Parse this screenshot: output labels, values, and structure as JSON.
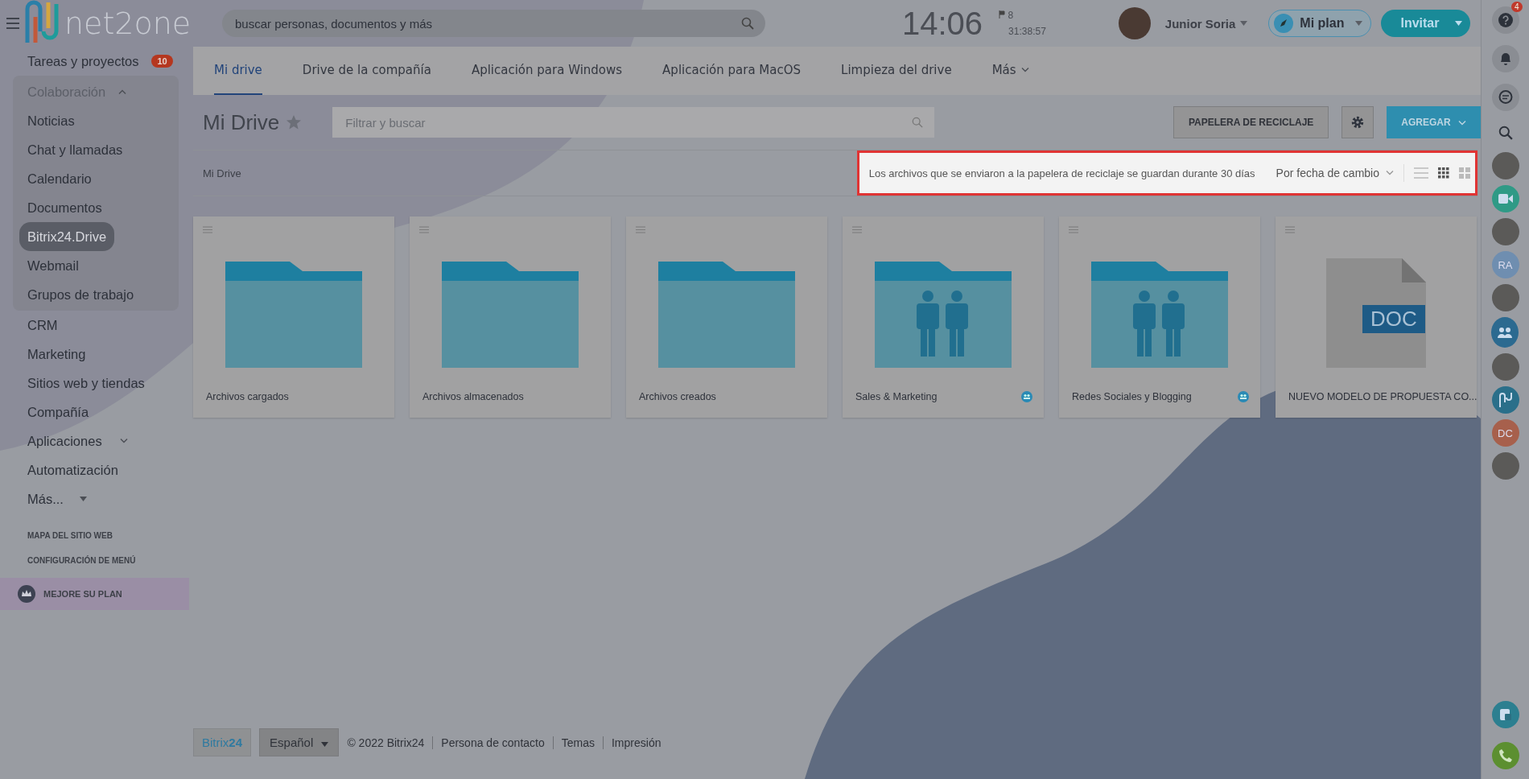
{
  "header": {
    "logo": "net2one",
    "search": {
      "placeholder": "buscar personas, documentos y más"
    },
    "clock": "14:06",
    "flag_count": "8",
    "timer": "31:38:57",
    "user": "Junior Soria",
    "plan_button": "Mi plan",
    "invite_button": "Invitar"
  },
  "sidebar": {
    "items": [
      {
        "label": "Tareas y proyectos",
        "badge": "10",
        "selected": false
      },
      {
        "label": "Colaboración",
        "expanded": true,
        "children": [
          {
            "label": "Noticias",
            "selected": false
          },
          {
            "label": "Chat y llamadas",
            "selected": false
          },
          {
            "label": "Calendario",
            "selected": false
          },
          {
            "label": "Documentos",
            "selected": false
          },
          {
            "label": "Bitrix24.Drive",
            "selected": true
          },
          {
            "label": "Webmail",
            "selected": false
          },
          {
            "label": "Grupos de trabajo",
            "selected": false
          }
        ]
      },
      {
        "label": "CRM",
        "selected": false
      },
      {
        "label": "Marketing",
        "selected": false
      },
      {
        "label": "Sitios web y tiendas",
        "selected": false
      },
      {
        "label": "Compañía",
        "selected": false
      },
      {
        "label": "Aplicaciones",
        "expanded": false,
        "selected": false
      },
      {
        "label": "Automatización",
        "selected": false
      },
      {
        "label": "Más...",
        "selected": false,
        "caret": true
      }
    ],
    "links": [
      "MAPA DEL SITIO WEB",
      "CONFIGURACIÓN DE MENÚ"
    ],
    "upgrade": "MEJORE SU PLAN"
  },
  "tabs": [
    {
      "label": "Mi drive",
      "selected": true
    },
    {
      "label": "Drive de la compañía",
      "selected": false
    },
    {
      "label": "Aplicación para Windows",
      "selected": false
    },
    {
      "label": "Aplicación para MacOS",
      "selected": false
    },
    {
      "label": "Limpieza del drive",
      "selected": false
    },
    {
      "label": "Más",
      "selected": false,
      "caret": true
    }
  ],
  "page": {
    "title": "Mi Drive",
    "filter": {
      "placeholder": "Filtrar y buscar"
    },
    "recycle_button": "PAPELERA DE RECICLAJE",
    "add_button": "AGREGAR"
  },
  "toolbar": {
    "breadcrumb": "Mi Drive",
    "notice": "Los archivos que se enviaron a la papelera de reciclaje se guardan durante 30 días",
    "sort": "Por fecha de cambio",
    "views": [
      {
        "kind": "list",
        "selected": false
      },
      {
        "kind": "grid",
        "selected": true
      },
      {
        "kind": "tiles",
        "selected": false
      }
    ]
  },
  "files": [
    {
      "kind": "folder",
      "name": "Archivos cargados",
      "shared": false
    },
    {
      "kind": "folder",
      "name": "Archivos almacenados",
      "shared": false
    },
    {
      "kind": "folder",
      "name": "Archivos creados",
      "shared": false
    },
    {
      "kind": "group_folder",
      "name": "Sales & Marketing",
      "shared": true
    },
    {
      "kind": "group_folder",
      "name": "Redes Sociales y Blogging",
      "shared": true
    },
    {
      "kind": "doc",
      "name": "NUEVO MODELO DE PROPUESTA CO...",
      "label": "DOC",
      "shared": false
    }
  ],
  "footer": {
    "logo": "Bitrix**24**",
    "language": "Español",
    "copyright": "© 2022 Bitrix24",
    "links": [
      "Persona de contacto",
      "Temas",
      "Impresión"
    ]
  },
  "right_panel": {
    "items": [
      {
        "kind": "help",
        "badge": "4"
      },
      {
        "kind": "bell"
      },
      {
        "kind": "chat"
      },
      {
        "kind": "search"
      },
      {
        "kind": "photo"
      },
      {
        "kind": "video"
      },
      {
        "kind": "photo"
      },
      {
        "kind": "initials",
        "text": "RA",
        "color": "#6f8eb0"
      },
      {
        "kind": "photo"
      },
      {
        "kind": "group"
      },
      {
        "kind": "photo"
      },
      {
        "kind": "logo"
      },
      {
        "kind": "initials",
        "text": "DC",
        "color": "#a7604c"
      },
      {
        "kind": "photo"
      }
    ],
    "bottom": [
      {
        "kind": "disk"
      },
      {
        "kind": "phone"
      }
    ]
  }
}
